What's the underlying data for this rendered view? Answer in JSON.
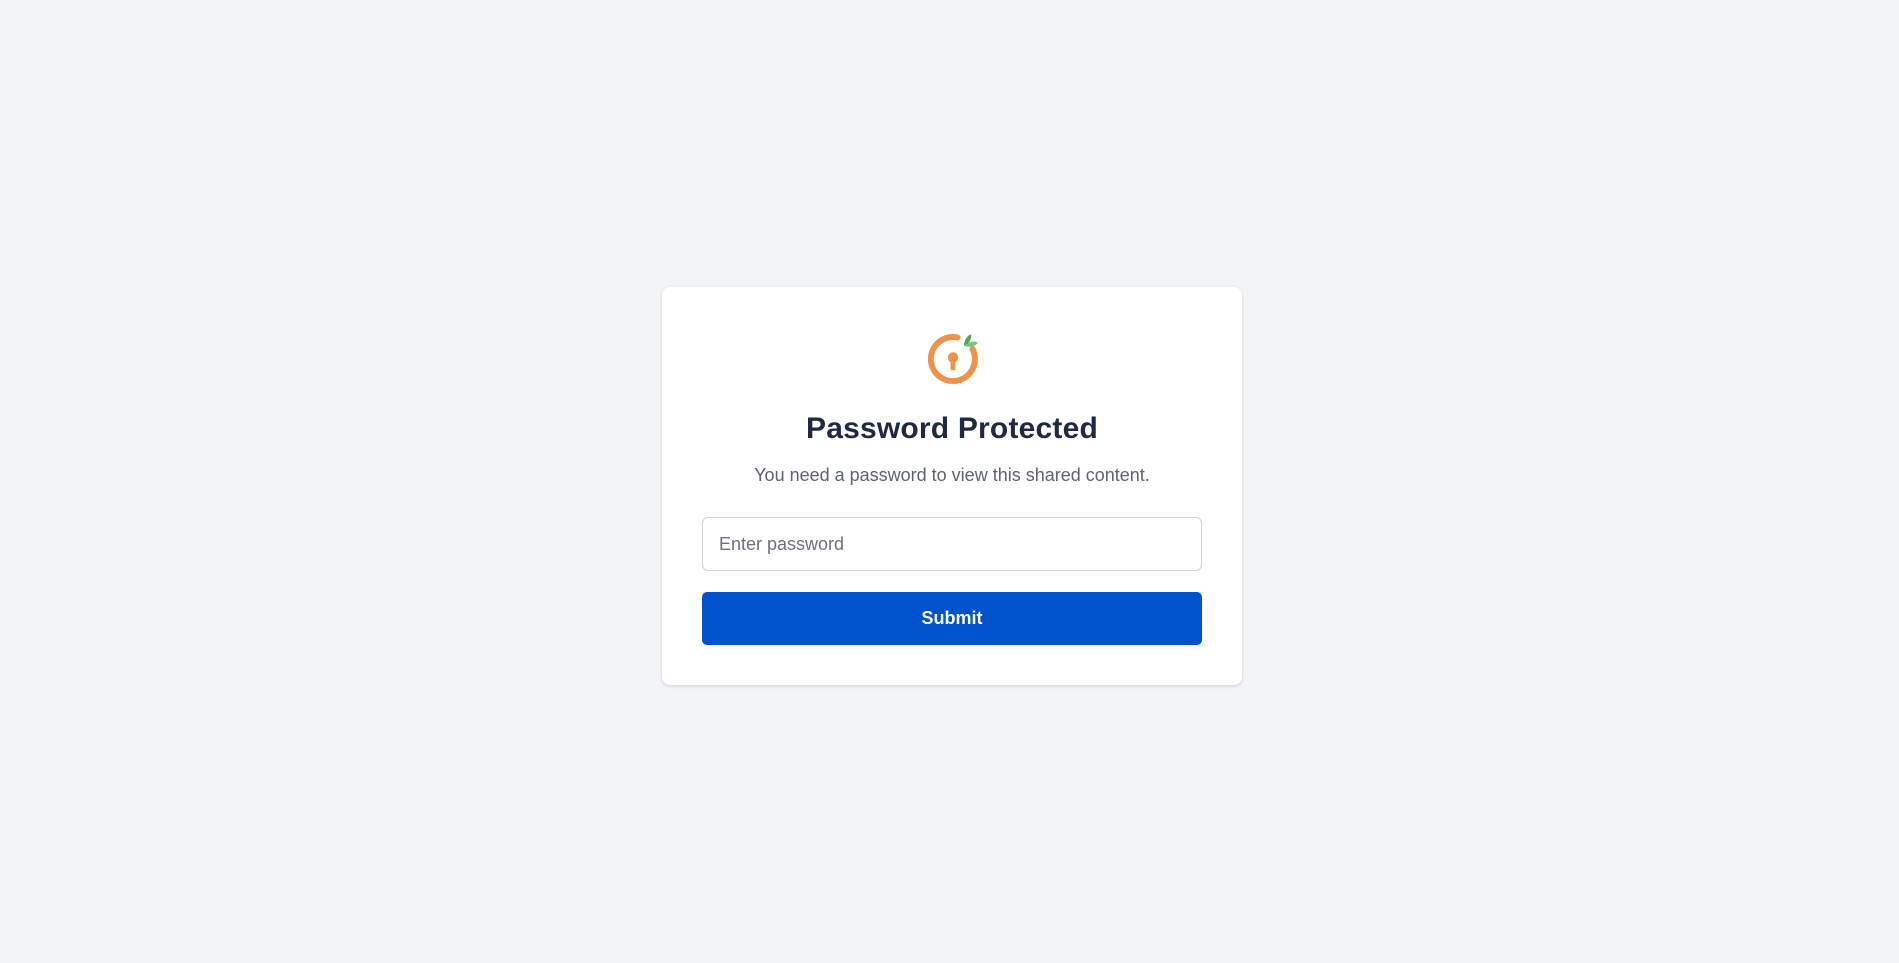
{
  "login": {
    "logo_icon": "orange-keyhole-icon",
    "title": "Password Protected",
    "subtitle": "You need a password to view this shared content.",
    "password_placeholder": "Enter password",
    "password_value": "",
    "submit_label": "Submit"
  },
  "colors": {
    "background": "#f3f4f6",
    "card": "#ffffff",
    "title": "#1e2a44",
    "subtitle": "#5b6474",
    "button": "#0052cc",
    "logo_orange": "#f0924a",
    "logo_leaf": "#5cb85c"
  }
}
